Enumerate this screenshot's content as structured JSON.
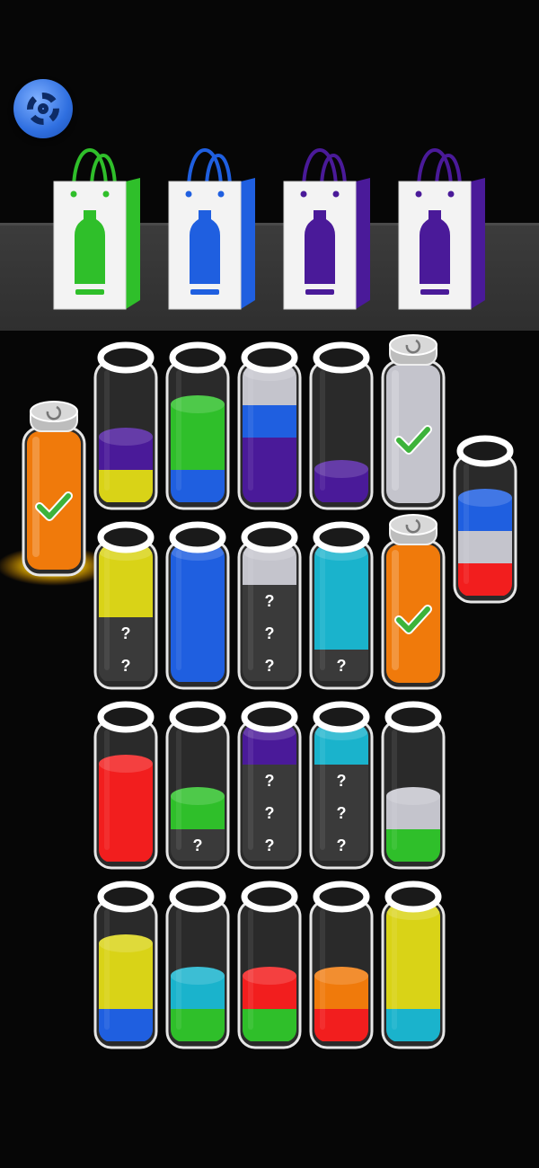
{
  "game": {
    "title": ""
  },
  "settings": {
    "icon": "gear-icon"
  },
  "palette": {
    "yellow": "#d9d317",
    "green": "#2fbf2a",
    "blue": "#1f5fe0",
    "purple": "#4a1a99",
    "red": "#f21e1e",
    "orange": "#f07a0b",
    "cyan": "#1ab3cc",
    "silver": "#c4c4cc",
    "empty": "#2d2d2d"
  },
  "bags": [
    {
      "color": "green",
      "completed": false
    },
    {
      "color": "blue",
      "completed": false
    },
    {
      "color": "purple",
      "completed": false
    },
    {
      "color": "purple",
      "completed": false
    }
  ],
  "tubes": [
    {
      "id": "t-left",
      "layers": [],
      "capacity": 4,
      "capped": true,
      "solid": "orange",
      "checked": true,
      "glow": true
    },
    {
      "id": "t-r1c1",
      "layers": [
        "yellow",
        "purple"
      ],
      "capacity": 4
    },
    {
      "id": "t-r1c2",
      "layers": [
        "blue",
        "green",
        "green"
      ],
      "capacity": 4
    },
    {
      "id": "t-r1c3",
      "layers": [
        "purple",
        "purple",
        "blue",
        "silver"
      ],
      "capacity": 4
    },
    {
      "id": "t-r1c4",
      "layers": [
        "purple"
      ],
      "capacity": 4
    },
    {
      "id": "t-r1c5",
      "layers": [],
      "capacity": 4,
      "capped": true,
      "solid": "silver",
      "checked": true
    },
    {
      "id": "t-right",
      "layers": [
        "red",
        "silver",
        "blue"
      ],
      "capacity": 4
    },
    {
      "id": "t-r2c1",
      "layers": [
        "unknown",
        "unknown",
        "yellow",
        "yellow"
      ],
      "capacity": 4
    },
    {
      "id": "t-r2c2",
      "layers": [
        "blue",
        "blue",
        "blue",
        "blue"
      ],
      "capacity": 4
    },
    {
      "id": "t-r2c3",
      "layers": [
        "unknown",
        "unknown",
        "unknown",
        "silver"
      ],
      "capacity": 4
    },
    {
      "id": "t-r2c4",
      "layers": [
        "unknown",
        "cyan",
        "cyan",
        "cyan"
      ],
      "capacity": 4
    },
    {
      "id": "t-r2c5",
      "layers": [],
      "capacity": 4,
      "capped": true,
      "solid": "orange",
      "checked": true
    },
    {
      "id": "t-r3c1",
      "layers": [
        "red",
        "red",
        "red"
      ],
      "capacity": 4
    },
    {
      "id": "t-r3c2",
      "layers": [
        "unknown",
        "green"
      ],
      "capacity": 4
    },
    {
      "id": "t-r3c3",
      "layers": [
        "unknown",
        "unknown",
        "unknown",
        "purple"
      ],
      "capacity": 4
    },
    {
      "id": "t-r3c4",
      "layers": [
        "unknown",
        "unknown",
        "unknown",
        "cyan"
      ],
      "capacity": 4
    },
    {
      "id": "t-r3c5",
      "layers": [
        "green",
        "silver"
      ],
      "capacity": 4
    },
    {
      "id": "t-r4c1",
      "layers": [
        "blue",
        "yellow",
        "yellow"
      ],
      "capacity": 4
    },
    {
      "id": "t-r4c2",
      "layers": [
        "green",
        "cyan"
      ],
      "capacity": 4
    },
    {
      "id": "t-r4c3",
      "layers": [
        "green",
        "red"
      ],
      "capacity": 4
    },
    {
      "id": "t-r4c4",
      "layers": [
        "red",
        "orange"
      ],
      "capacity": 4
    },
    {
      "id": "t-r4c5",
      "layers": [
        "cyan",
        "yellow",
        "yellow",
        "yellow"
      ],
      "capacity": 4
    }
  ],
  "unknown_mark": "?"
}
